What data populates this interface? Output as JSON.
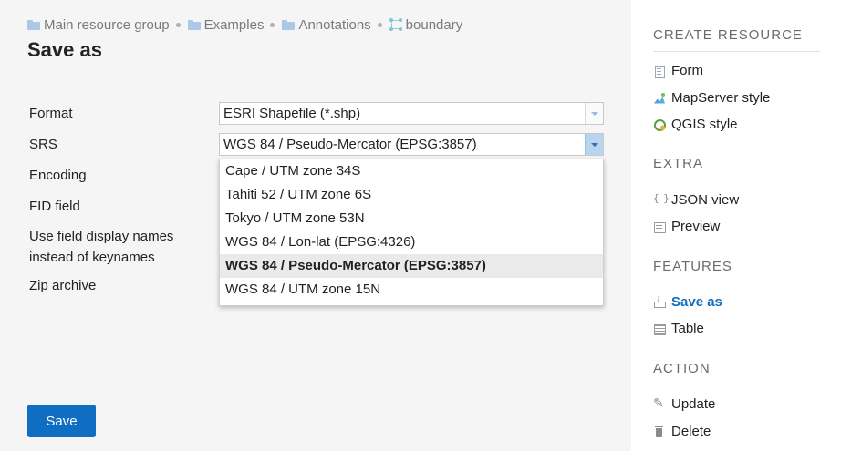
{
  "breadcrumb": [
    {
      "label": "Main resource group",
      "icon": "folder-icon"
    },
    {
      "label": "Examples",
      "icon": "folder-icon"
    },
    {
      "label": "Annotations",
      "icon": "folder-icon"
    },
    {
      "label": "boundary",
      "icon": "boundary-layer-icon"
    }
  ],
  "page_title": "Save as",
  "form": {
    "format_label": "Format",
    "format_value": "ESRI Shapefile (*.shp)",
    "srs_label": "SRS",
    "srs_value": "WGS 84 / Pseudo-Mercator (EPSG:3857)",
    "encoding_label": "Encoding",
    "fid_label": "FID field",
    "display_names_label_1": "Use field display names",
    "display_names_label_2": "instead of keynames",
    "zip_label": "Zip archive",
    "srs_options": [
      "Cape / UTM zone 34S",
      "Tahiti 52 / UTM zone 6S",
      "Tokyo / UTM zone 53N",
      "WGS 84 / Lon-lat (EPSG:4326)",
      "WGS 84 / Pseudo-Mercator (EPSG:3857)",
      "WGS 84 / UTM zone 15N"
    ],
    "srs_selected_index": 4,
    "save_button": "Save"
  },
  "sidebar": {
    "create_heading": "Create resource",
    "create_items": [
      {
        "label": "Form",
        "icon": "form-icon"
      },
      {
        "label": "MapServer style",
        "icon": "mapserver-icon"
      },
      {
        "label": "QGIS style",
        "icon": "qgis-icon"
      }
    ],
    "extra_heading": "Extra",
    "extra_items": [
      {
        "label": "JSON view",
        "icon": "json-icon"
      },
      {
        "label": "Preview",
        "icon": "preview-icon"
      }
    ],
    "features_heading": "Features",
    "features_items": [
      {
        "label": "Save as",
        "icon": "save-icon",
        "active": true
      },
      {
        "label": "Table",
        "icon": "table-icon"
      }
    ],
    "action_heading": "Action",
    "action_items": [
      {
        "label": "Update",
        "icon": "pencil-icon"
      },
      {
        "label": "Delete",
        "icon": "trash-icon"
      }
    ]
  },
  "colors": {
    "accent": "#0f6ec1",
    "background": "#f5f5f5",
    "sidebar_background": "#ffffff"
  }
}
